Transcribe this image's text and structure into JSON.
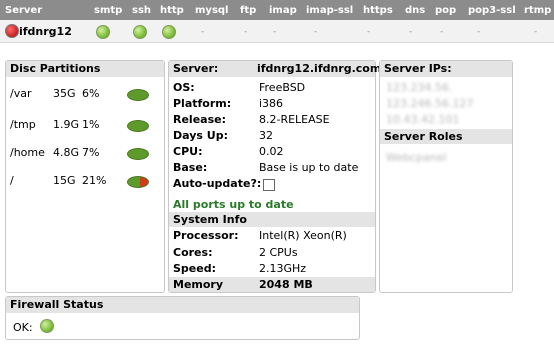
{
  "header": {
    "columns": [
      "Server",
      "smtp",
      "ssh",
      "http",
      "mysql",
      "ftp",
      "imap",
      "imap-ssl",
      "https",
      "dns",
      "pop",
      "pop3-ssl",
      "rtmp"
    ]
  },
  "server_row": {
    "name": "ifdnrg12",
    "dash": "-"
  },
  "disc": {
    "title": "Disc Partitions",
    "rows": [
      {
        "mount": "/var",
        "size": "35G",
        "pct": "6%",
        "used_fraction": 0.06
      },
      {
        "mount": "/tmp",
        "size": "1.9G",
        "pct": "1%",
        "used_fraction": 0.01
      },
      {
        "mount": "/home",
        "size": "4.8G",
        "pct": "7%",
        "used_fraction": 0.07
      },
      {
        "mount": "/",
        "size": "15G",
        "pct": "21%",
        "used_fraction": 0.21
      }
    ]
  },
  "server_info": {
    "title_label": "Server:",
    "title_value": "ifdnrg12.ifdnrg.com",
    "rows": [
      {
        "label": "OS:",
        "value": "FreeBSD"
      },
      {
        "label": "Platform:",
        "value": "i386"
      },
      {
        "label": "Release:",
        "value": "8.2-RELEASE"
      },
      {
        "label": "Days Up:",
        "value": "32"
      },
      {
        "label": "CPU:",
        "value": "0.02"
      },
      {
        "label": "Base:",
        "value": "Base is up to date"
      },
      {
        "label": "Auto-update?:",
        "value": ""
      }
    ],
    "ports_status": "All ports up to date",
    "system_info_title": "System Info",
    "sys_rows": [
      {
        "label": "Processor:",
        "value": "Intel(R) Xeon(R)"
      },
      {
        "label": "Cores:",
        "value": "2 CPUs"
      },
      {
        "label": "Speed:",
        "value": "2.13GHz"
      }
    ],
    "memory_label": "Memory",
    "memory_value": "2048 MB"
  },
  "server_ips": {
    "title": "Server IPs:",
    "ips": [
      "123.234.56.",
      "123.246.56.127",
      "10.43.42.101"
    ],
    "roles_title": "Server Roles",
    "roles": [
      "Webcpanel"
    ]
  },
  "firewall": {
    "title": "Firewall Status",
    "status_label": "OK:"
  },
  "colors": {
    "header_bg": "#8c8c8c",
    "ok_green": "#7fbf3a",
    "ports_green": "#2a7a2a",
    "alert_red": "#c00000"
  }
}
